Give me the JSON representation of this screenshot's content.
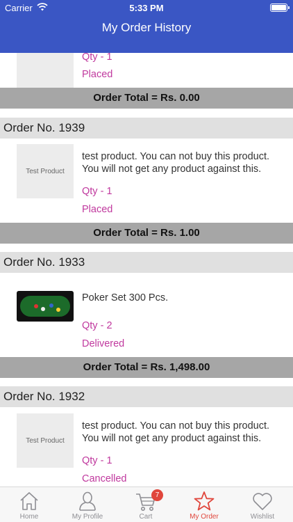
{
  "status_bar": {
    "carrier": "Carrier",
    "time": "5:33 PM"
  },
  "header": {
    "title": "My Order History"
  },
  "orders": [
    {
      "number_label": "",
      "items": [
        {
          "name": "",
          "qty": "Qty - 1",
          "status": "Placed"
        }
      ],
      "total": "Order Total = Rs. 0.00"
    },
    {
      "number_label": "Order No. 1939",
      "items": [
        {
          "thumbnail_text": "Test Product",
          "name": "test product. You can not buy this product. You will not get any product against this.",
          "qty": "Qty - 1",
          "status": "Placed"
        }
      ],
      "total": "Order Total = Rs. 1.00"
    },
    {
      "number_label": "Order No. 1933",
      "items": [
        {
          "name": "Poker Set 300 Pcs.",
          "qty": "Qty - 2",
          "status": "Delivered"
        }
      ],
      "total": "Order Total = Rs. 1,498.00"
    },
    {
      "number_label": "Order No. 1932",
      "items": [
        {
          "thumbnail_text": "Test Product",
          "name": "test product. You can not buy this product. You will not get any product against this.",
          "qty": "Qty - 1",
          "status": "Cancelled"
        }
      ]
    }
  ],
  "tabbar": {
    "items": [
      {
        "label": "Home",
        "icon": "home-icon"
      },
      {
        "label": "My Profile",
        "icon": "profile-icon"
      },
      {
        "label": "Cart",
        "icon": "cart-icon",
        "badge": "7"
      },
      {
        "label": "My Order",
        "icon": "star-icon",
        "active": true
      },
      {
        "label": "Wishlist",
        "icon": "heart-icon"
      }
    ]
  },
  "colors": {
    "header": "#3a56c4",
    "accent_status": "#c0399e",
    "active_tab": "#e0463c"
  }
}
